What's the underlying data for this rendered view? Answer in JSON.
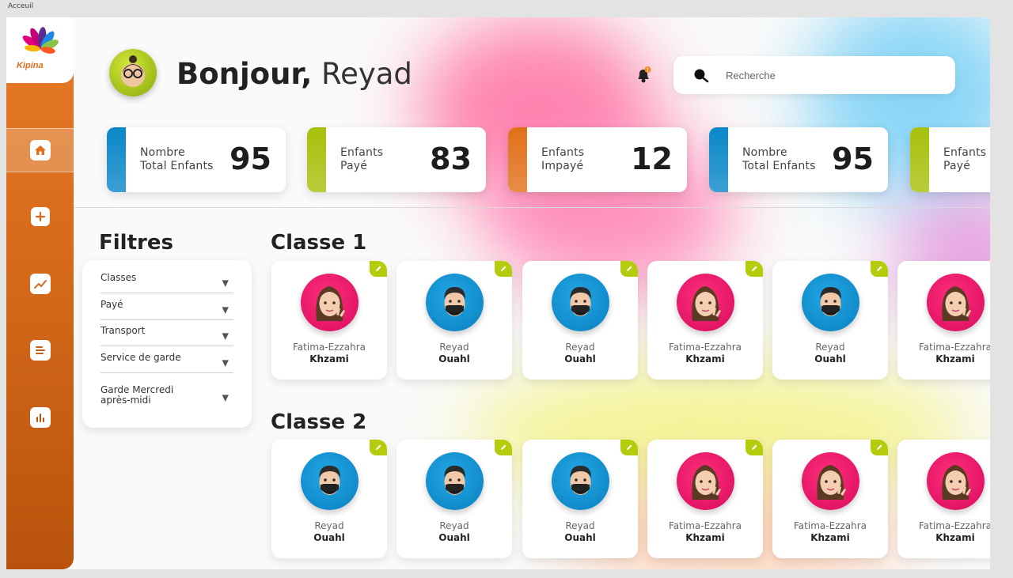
{
  "window": {
    "title": "Acceuil"
  },
  "brand": {
    "logo_text": "Kipina"
  },
  "header": {
    "greeting_bold": "Bonjour,",
    "user_name": "Reyad",
    "search_placeholder": "Recherche",
    "notification_count": "1"
  },
  "stats": [
    {
      "label": "Nombre\nTotal Enfants",
      "value": "95",
      "color": "#0a87c8"
    },
    {
      "label": "Enfants\nPayé",
      "value": "83",
      "color": "#a7c00b"
    },
    {
      "label": "Enfants\nImpayé",
      "value": "12",
      "color": "#e0701a"
    },
    {
      "label": "Nombre\nTotal Enfants",
      "value": "95",
      "color": "#0a87c8"
    },
    {
      "label": "Enfants\nPayé",
      "value": "",
      "color": "#a7c00b"
    }
  ],
  "filters": {
    "title": "Filtres",
    "items": [
      {
        "label": "Classes"
      },
      {
        "label": "Payé"
      },
      {
        "label": "Transport"
      },
      {
        "label": "Service de garde"
      },
      {
        "label": "Garde Mercredi après-midi"
      }
    ]
  },
  "classes": [
    {
      "title": "Classe 1",
      "kids": [
        {
          "first": "Fatima-Ezzahra",
          "last": "Khzami",
          "avatar": "girl"
        },
        {
          "first": "Reyad",
          "last": "Ouahl",
          "avatar": "boy"
        },
        {
          "first": "Reyad",
          "last": "Ouahl",
          "avatar": "boy"
        },
        {
          "first": "Fatima-Ezzahra",
          "last": "Khzami",
          "avatar": "girl"
        },
        {
          "first": "Reyad",
          "last": "Ouahl",
          "avatar": "boy"
        },
        {
          "first": "Fatima-Ezzahra",
          "last": "Khzami",
          "avatar": "girl"
        }
      ]
    },
    {
      "title": "Classe 2",
      "kids": [
        {
          "first": "Reyad",
          "last": "Ouahl",
          "avatar": "boy"
        },
        {
          "first": "Reyad",
          "last": "Ouahl",
          "avatar": "boy"
        },
        {
          "first": "Reyad",
          "last": "Ouahl",
          "avatar": "boy"
        },
        {
          "first": "Fatima-Ezzahra",
          "last": "Khzami",
          "avatar": "girl"
        },
        {
          "first": "Fatima-Ezzahra",
          "last": "Khzami",
          "avatar": "girl"
        },
        {
          "first": "Fatima-Ezzahra",
          "last": "Khzami",
          "avatar": "girl"
        }
      ]
    }
  ],
  "nav": {
    "items": [
      {
        "icon": "home-icon",
        "active": true
      },
      {
        "icon": "add-icon",
        "active": false
      },
      {
        "icon": "chart-icon",
        "active": false
      },
      {
        "icon": "list-icon",
        "active": false
      },
      {
        "icon": "bar-chart-icon",
        "active": false
      }
    ]
  }
}
